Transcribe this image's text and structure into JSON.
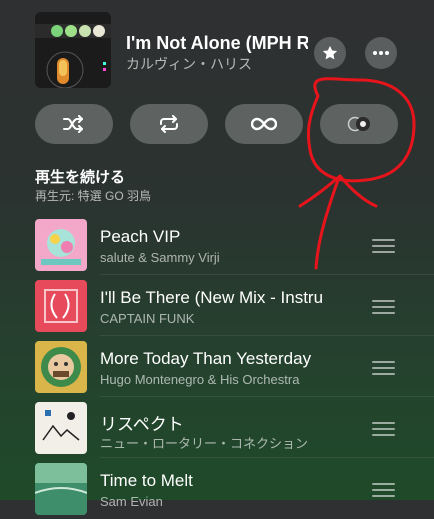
{
  "now_playing": {
    "title": "I'm Not Alone (MPH R",
    "artist": "カルヴィン・ハリス",
    "artwork_icon": "album-artwork"
  },
  "header_actions": {
    "favorite_icon": "star-icon",
    "more_icon": "ellipsis-icon"
  },
  "controls": [
    {
      "name": "shuffle",
      "icon": "shuffle-icon"
    },
    {
      "name": "repeat",
      "icon": "repeat-icon"
    },
    {
      "name": "infinity",
      "icon": "infinity-icon"
    },
    {
      "name": "autoplay",
      "icon": "autoplay-icon"
    }
  ],
  "section": {
    "title": "再生を続ける",
    "subtitle": "再生元: 特選 GO 羽鳥"
  },
  "queue": [
    {
      "title": "Peach VIP",
      "artist": "salute & Sammy Virji"
    },
    {
      "title": "I'll Be There (New Mix - Instru",
      "artist": "CAPTAIN FUNK"
    },
    {
      "title": "More Today Than Yesterday",
      "artist": "Hugo Montenegro & His Orchestra"
    },
    {
      "title": "リスペクト",
      "artist": "ニュー・ロータリー・コネクション"
    },
    {
      "title": "Time to Melt",
      "artist": "Sam Evian"
    }
  ],
  "annotation": {
    "color": "#e8141c",
    "shape": "hand-drawn circle with arrow pointing to autoplay button"
  }
}
